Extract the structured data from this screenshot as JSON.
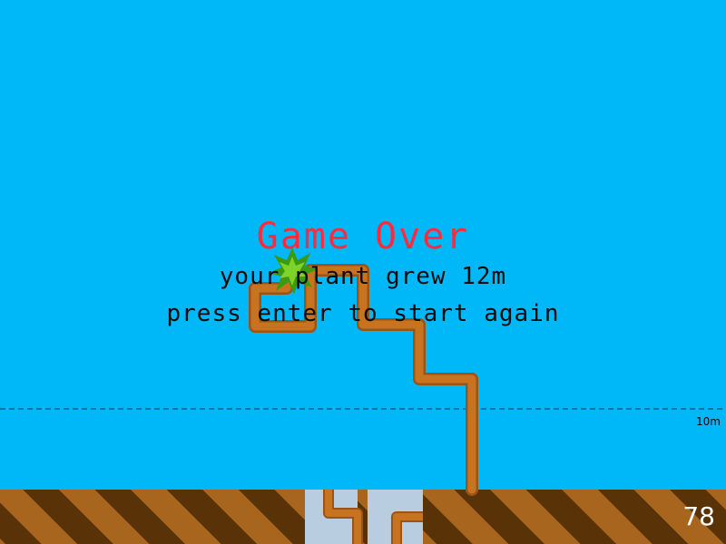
{
  "game": {
    "title": "Game Over",
    "score_text": "your plant grew 12m",
    "restart_text": "press enter to start again",
    "height_marker_label": "10m",
    "fps_counter": "78"
  },
  "colors": {
    "sky": "#00b8f8",
    "title": "#ff2a3c",
    "text": "#0a0a0a",
    "stem": "#c8731f",
    "stem_dark": "#9a5418",
    "leaf": "#3c9a12",
    "leaf_light": "#7ed22a",
    "ground_dark": "#5a3208",
    "ground_light": "#a8651e",
    "pit": "#b8cde0",
    "hud_text": "#ffffff"
  },
  "icons": {
    "plant_head": "plant-head-icon"
  }
}
